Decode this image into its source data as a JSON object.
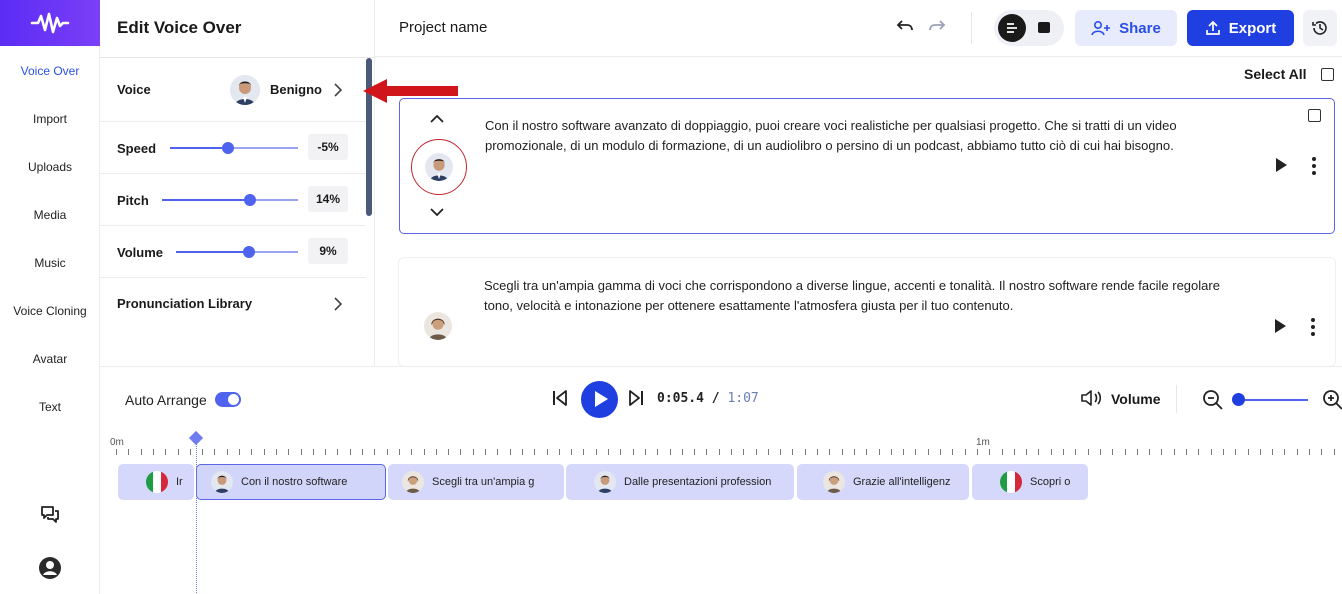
{
  "nav": {
    "items": [
      {
        "label": "Voice Over",
        "active": true
      },
      {
        "label": "Import",
        "active": false
      },
      {
        "label": "Uploads",
        "active": false
      },
      {
        "label": "Media",
        "active": false
      },
      {
        "label": "Music",
        "active": false
      },
      {
        "label": "Voice Cloning",
        "active": false
      },
      {
        "label": "Avatar",
        "active": false
      },
      {
        "label": "Text",
        "active": false
      }
    ],
    "bottom_icons": [
      "chat-icon",
      "user-icon"
    ]
  },
  "edit_panel": {
    "title": "Edit Voice Over",
    "voice": {
      "label": "Voice",
      "name": "Benigno"
    },
    "speed": {
      "label": "Speed",
      "value": "-5%",
      "level": 0.45
    },
    "pitch": {
      "label": "Pitch",
      "value": "14%",
      "level": 0.65
    },
    "volume": {
      "label": "Volume",
      "value": "9%",
      "level": 0.6
    },
    "pronunciation": {
      "label": "Pronunciation Library"
    }
  },
  "topbar": {
    "project_name": "Project name",
    "share_label": "Share",
    "export_label": "Export",
    "icons": [
      "undo-icon",
      "redo-icon",
      "align-icon",
      "square-icon",
      "add-user-icon",
      "upload-icon",
      "history-icon"
    ]
  },
  "select_all_label": "Select All",
  "cards": [
    {
      "text": "Con il nostro software avanzato di doppiaggio, puoi creare voci realistiche per qualsiasi progetto. Che si tratti di un video promozionale, di un modulo di formazione, di un audiolibro o persino di un podcast, abbiamo tutto ciò di cui hai bisogno.",
      "selected": true
    },
    {
      "text": "Scegli tra un'ampia gamma di voci che corrispondono a diverse lingue, accenti e tonalità. Il nostro software rende facile regolare tono, velocità e intonazione per ottenere esattamente l'atmosfera giusta per il tuo contenuto.",
      "selected": false
    }
  ],
  "transport": {
    "auto_arrange_label": "Auto Arrange",
    "auto_arrange_on": true,
    "time_current": "0:05.4",
    "time_sep": " / ",
    "time_total": "1:07",
    "volume_label": "Volume"
  },
  "timeline": {
    "ruler_labels": [
      "0m",
      "1m"
    ],
    "clips": [
      {
        "label": "Ir",
        "kind": "flag"
      },
      {
        "label": "Con il nostro software",
        "kind": "avatar",
        "selected": true
      },
      {
        "label": "Scegli tra un'ampia g",
        "kind": "avatar"
      },
      {
        "label": "Dalle presentazioni profession",
        "kind": "avatar"
      },
      {
        "label": "Grazie all'intelligenz",
        "kind": "avatar"
      },
      {
        "label": "Scopri o",
        "kind": "flag"
      }
    ]
  },
  "colors": {
    "accent": "#1f3fe0",
    "brand": "#5b2cf5",
    "annotation": "#d0151b"
  }
}
